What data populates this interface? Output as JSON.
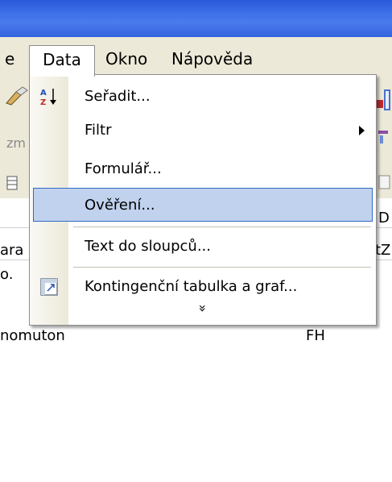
{
  "menubar": {
    "left_fragment": "e",
    "data_label": "Data",
    "okno_label": "Okno",
    "napoveda_label": "Nápověda"
  },
  "toolbar": {
    "left_fragment": "zm"
  },
  "menu": {
    "items": [
      {
        "label": "Seřadit...",
        "icon": "sort-az-icon"
      },
      {
        "label": "Filtr",
        "submenu": true
      },
      {
        "label": "Formulář..."
      },
      {
        "label": "Ověření...",
        "selected": true
      },
      {
        "label": "Text do sloupců..."
      },
      {
        "label": "Kontingenční tabulka a graf...",
        "icon": "pivot-table-icon"
      }
    ],
    "expand_glyph": "»"
  },
  "sheet": {
    "fragments": [
      "ara",
      "o.",
      "nomuton",
      "D",
      "tZ",
      "FH"
    ]
  },
  "colors": {
    "titlebar": "#3d6fe8",
    "menu_bg": "#ffffff",
    "selection_bg": "#c1d2ee",
    "selection_border": "#316ac5",
    "chrome": "#ece9d8"
  }
}
